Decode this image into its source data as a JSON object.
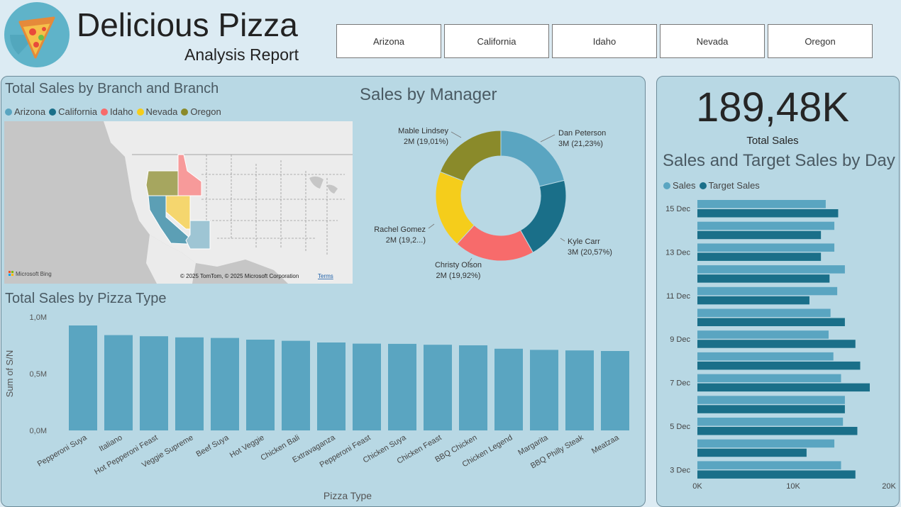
{
  "header": {
    "title": "Delicious Pizza",
    "subtitle": "Analysis Report"
  },
  "slicer": {
    "items": [
      "Arizona",
      "California",
      "Idaho",
      "Nevada",
      "Oregon"
    ]
  },
  "colors": {
    "arizona": "#5aa5c1",
    "california": "#1a6f89",
    "idaho": "#f76b6b",
    "nevada": "#f5cd1b",
    "oregon": "#8a8a2a",
    "panel": "#b8d8e4",
    "page": "#dcebf3"
  },
  "map_visual": {
    "title": "Total Sales by Branch and Branch",
    "legend": [
      "Arizona",
      "California",
      "Idaho",
      "Nevada",
      "Oregon"
    ],
    "attribution": "© 2025 TomTom, © 2025 Microsoft Corporation",
    "terms": "Terms",
    "bing": "Microsoft Bing"
  },
  "kpi": {
    "value": "189,48K",
    "label": "Total Sales"
  },
  "chart_data": [
    {
      "type": "pie",
      "title": "Sales by Manager",
      "slices": [
        {
          "name": "Dan Peterson",
          "value": 21.23,
          "label": "3M (21,23%)",
          "color": "#5aa5c1"
        },
        {
          "name": "Kyle Carr",
          "value": 20.57,
          "label": "3M (20,57%)",
          "color": "#1a6f89"
        },
        {
          "name": "Christy Olson",
          "value": 19.92,
          "label": "2M (19,92%)",
          "color": "#f76b6b"
        },
        {
          "name": "Rachel Gomez",
          "value": 19.27,
          "label": "2M (19,2...)",
          "color": "#f5cd1b"
        },
        {
          "name": "Mable Lindsey",
          "value": 19.01,
          "label": "2M (19,01%)",
          "color": "#8a8a2a"
        }
      ]
    },
    {
      "type": "bar",
      "title": "Total Sales by Pizza Type",
      "xlabel": "Pizza Type",
      "ylabel": "Sum of S/N",
      "ylim": [
        0,
        1000000
      ],
      "yticks": [
        "0,0M",
        "0,5M",
        "1,0M"
      ],
      "categories": [
        "Pepperoni Suya",
        "Italiano",
        "Hot Pepperoni Feast",
        "Veggie Supreme",
        "Beef Suya",
        "Hot Veggie",
        "Chicken Bali",
        "Extravaganza",
        "Pepperoni Feast",
        "Chicken Suya",
        "Chicken Feast",
        "BBQ Chicken",
        "Chicken Legend",
        "Margarita",
        "BBQ Philly Steak",
        "Meatzaa"
      ],
      "values": [
        925000,
        840000,
        830000,
        820000,
        815000,
        800000,
        790000,
        775000,
        765000,
        763000,
        755000,
        750000,
        720000,
        710000,
        705000,
        700000
      ],
      "color": "#5aa5c1"
    },
    {
      "type": "bar",
      "orientation": "horizontal",
      "title": "Sales and Target Sales by Day",
      "legend": [
        "Sales",
        "Target Sales"
      ],
      "xlim": [
        0,
        20000
      ],
      "xticks": [
        "0K",
        "10K",
        "20K"
      ],
      "categories": [
        "15 Dec",
        "14 Dec",
        "13 Dec",
        "12 Dec",
        "11 Dec",
        "10 Dec",
        "9 Dec",
        "8 Dec",
        "7 Dec",
        "6 Dec",
        "5 Dec",
        "4 Dec",
        "3 Dec"
      ],
      "category_labels": [
        "15 Dec",
        "",
        "13 Dec",
        "",
        "11 Dec",
        "",
        "9 Dec",
        "",
        "7 Dec",
        "",
        "5 Dec",
        "",
        "3 Dec"
      ],
      "series": [
        {
          "name": "Sales",
          "color": "#5aa5c1",
          "values": [
            13400,
            14300,
            14300,
            15400,
            14600,
            13900,
            13700,
            14200,
            15000,
            15400,
            15200,
            14300,
            15000
          ]
        },
        {
          "name": "Target Sales",
          "color": "#1a6f89",
          "values": [
            14700,
            12900,
            12900,
            13800,
            11700,
            15400,
            16500,
            17000,
            18000,
            15400,
            16700,
            11400,
            16500
          ]
        }
      ]
    }
  ]
}
